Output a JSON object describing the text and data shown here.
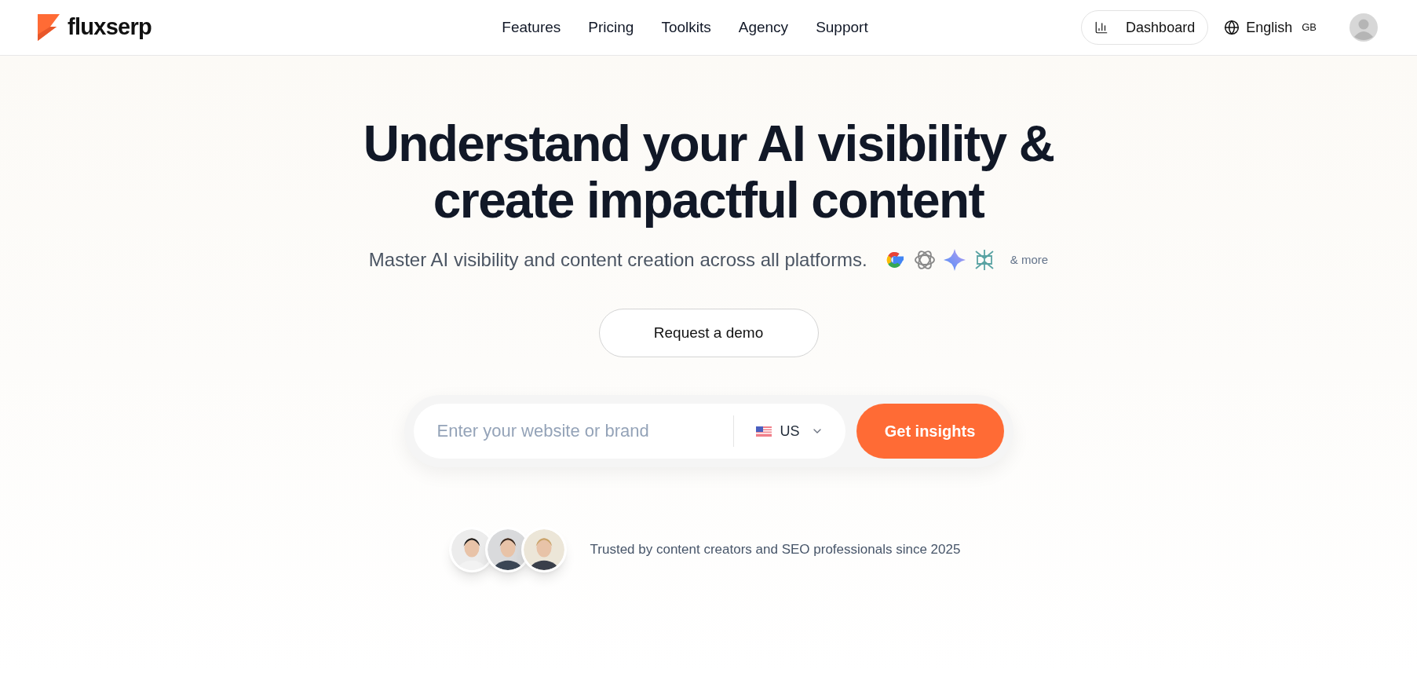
{
  "header": {
    "logo": "fluxserp",
    "nav": [
      {
        "label": "Features"
      },
      {
        "label": "Pricing"
      },
      {
        "label": "Toolkits"
      },
      {
        "label": "Agency"
      },
      {
        "label": "Support"
      }
    ],
    "dashboard_button": "Dashboard",
    "language": {
      "label": "English",
      "region": "GB"
    }
  },
  "hero": {
    "title_lines": [
      "Understand your AI visibility &",
      "create impactful content"
    ],
    "subtitle": "Master AI visibility and content creation across all platforms.",
    "platforms_more": "& more",
    "demo_button": "Request a demo"
  },
  "search": {
    "placeholder": "Enter your website or brand",
    "country": "US",
    "submit": "Get insights"
  },
  "trust": {
    "avatars": [
      {
        "kind": "person"
      },
      {
        "kind": "person"
      },
      {
        "kind": "person"
      }
    ],
    "text": "Trusted by content creators and SEO professionals since 2025"
  }
}
